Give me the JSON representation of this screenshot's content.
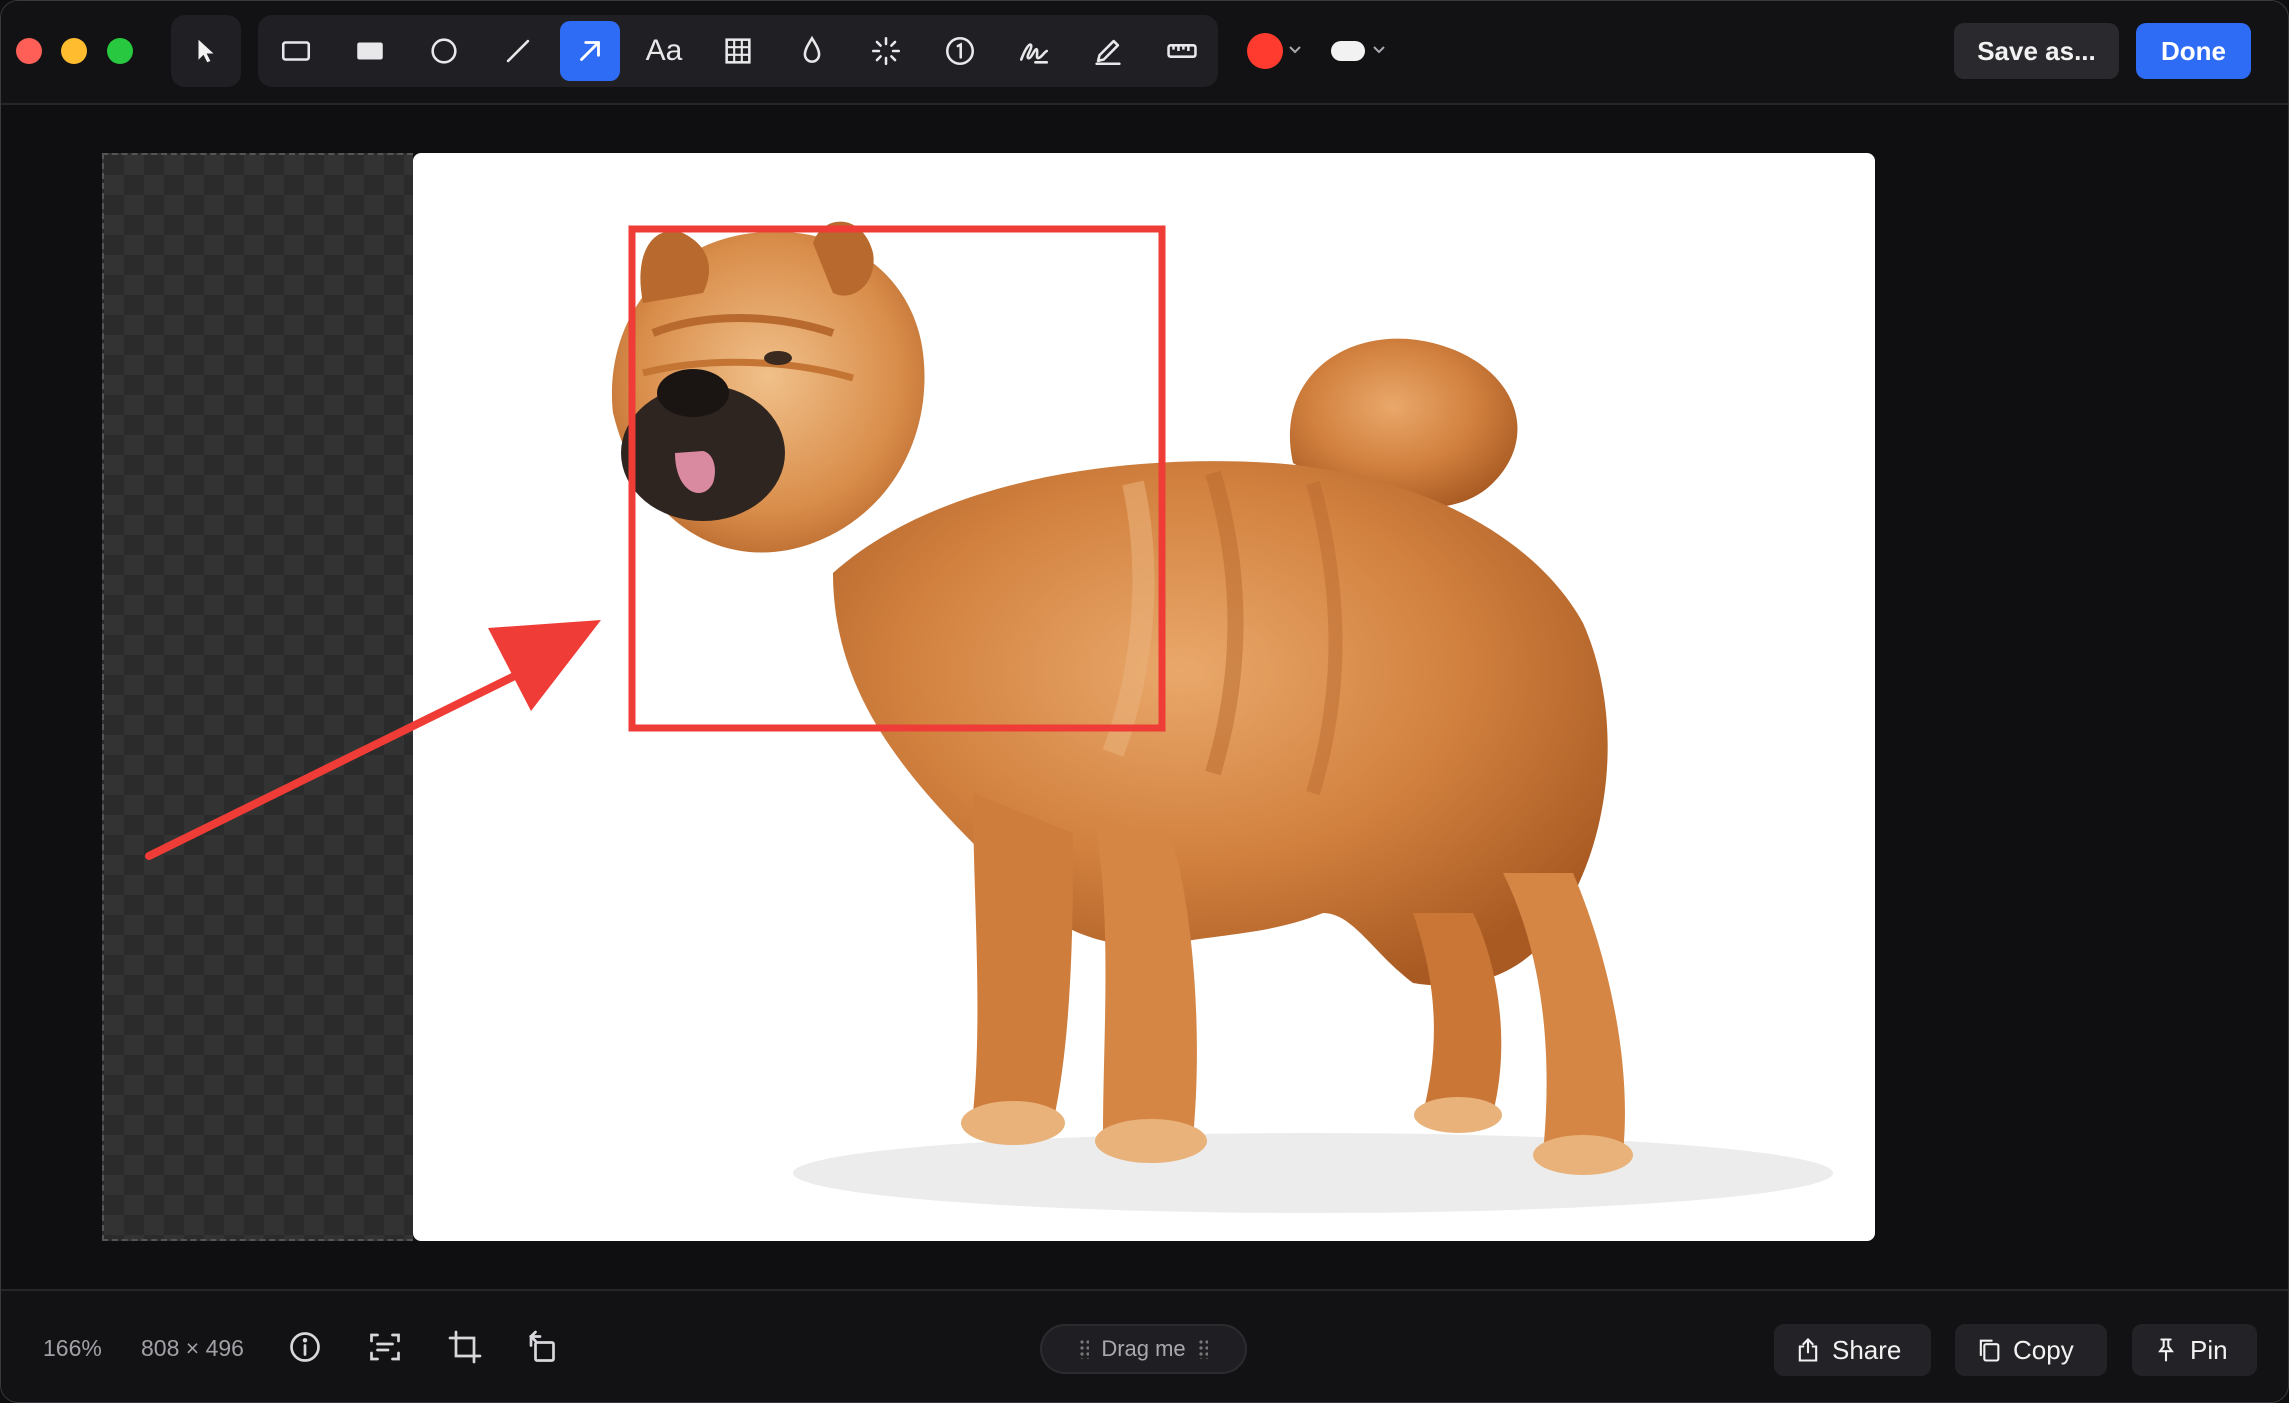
{
  "window": {
    "traffic_lights": [
      "close",
      "minimize",
      "zoom"
    ]
  },
  "toolbar": {
    "tools": [
      {
        "name": "select-tool",
        "icon": "cursor-arrow-icon"
      },
      {
        "name": "rectangle-tool",
        "icon": "rectangle-outline-icon"
      },
      {
        "name": "filled-rectangle-tool",
        "icon": "rectangle-filled-icon"
      },
      {
        "name": "ellipse-tool",
        "icon": "circle-outline-icon"
      },
      {
        "name": "line-tool",
        "icon": "line-icon"
      },
      {
        "name": "arrow-tool",
        "icon": "arrow-up-right-icon",
        "active": true
      },
      {
        "name": "text-tool",
        "icon": "text-icon",
        "label": "Aa"
      },
      {
        "name": "pixelate-tool",
        "icon": "grid-icon"
      },
      {
        "name": "blur-tool",
        "icon": "droplet-icon"
      },
      {
        "name": "spotlight-tool",
        "icon": "sparkle-icon"
      },
      {
        "name": "counter-tool",
        "icon": "numbered-circle-icon"
      },
      {
        "name": "signature-tool",
        "icon": "signature-icon"
      },
      {
        "name": "highlighter-tool",
        "icon": "pencil-icon"
      },
      {
        "name": "ruler-tool",
        "icon": "ruler-icon"
      }
    ],
    "color": "#ff3b30",
    "save_label": "Save as...",
    "done_label": "Done"
  },
  "annotations": {
    "color": "#f03c36",
    "items": [
      "rectangle",
      "arrow"
    ]
  },
  "footer": {
    "zoom": "166%",
    "dimensions": "808 × 496",
    "drag_label": "Drag me",
    "share_label": "Share",
    "copy_label": "Copy",
    "pin_label": "Pin"
  },
  "colors": {
    "accent": "#2f6cf6",
    "background": "#0f0f11",
    "button_bg": "#2a2a2e"
  }
}
